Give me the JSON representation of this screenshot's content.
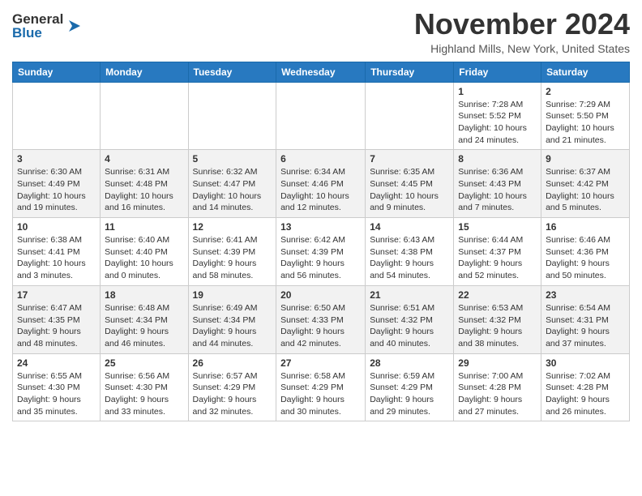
{
  "header": {
    "logo_general": "General",
    "logo_blue": "Blue",
    "title": "November 2024",
    "location": "Highland Mills, New York, United States"
  },
  "calendar": {
    "days_of_week": [
      "Sunday",
      "Monday",
      "Tuesday",
      "Wednesday",
      "Thursday",
      "Friday",
      "Saturday"
    ],
    "weeks": [
      [
        {
          "date": "",
          "info": ""
        },
        {
          "date": "",
          "info": ""
        },
        {
          "date": "",
          "info": ""
        },
        {
          "date": "",
          "info": ""
        },
        {
          "date": "",
          "info": ""
        },
        {
          "date": "1",
          "info": "Sunrise: 7:28 AM\nSunset: 5:52 PM\nDaylight: 10 hours and 24 minutes."
        },
        {
          "date": "2",
          "info": "Sunrise: 7:29 AM\nSunset: 5:50 PM\nDaylight: 10 hours and 21 minutes."
        }
      ],
      [
        {
          "date": "3",
          "info": "Sunrise: 6:30 AM\nSunset: 4:49 PM\nDaylight: 10 hours and 19 minutes."
        },
        {
          "date": "4",
          "info": "Sunrise: 6:31 AM\nSunset: 4:48 PM\nDaylight: 10 hours and 16 minutes."
        },
        {
          "date": "5",
          "info": "Sunrise: 6:32 AM\nSunset: 4:47 PM\nDaylight: 10 hours and 14 minutes."
        },
        {
          "date": "6",
          "info": "Sunrise: 6:34 AM\nSunset: 4:46 PM\nDaylight: 10 hours and 12 minutes."
        },
        {
          "date": "7",
          "info": "Sunrise: 6:35 AM\nSunset: 4:45 PM\nDaylight: 10 hours and 9 minutes."
        },
        {
          "date": "8",
          "info": "Sunrise: 6:36 AM\nSunset: 4:43 PM\nDaylight: 10 hours and 7 minutes."
        },
        {
          "date": "9",
          "info": "Sunrise: 6:37 AM\nSunset: 4:42 PM\nDaylight: 10 hours and 5 minutes."
        }
      ],
      [
        {
          "date": "10",
          "info": "Sunrise: 6:38 AM\nSunset: 4:41 PM\nDaylight: 10 hours and 3 minutes."
        },
        {
          "date": "11",
          "info": "Sunrise: 6:40 AM\nSunset: 4:40 PM\nDaylight: 10 hours and 0 minutes."
        },
        {
          "date": "12",
          "info": "Sunrise: 6:41 AM\nSunset: 4:39 PM\nDaylight: 9 hours and 58 minutes."
        },
        {
          "date": "13",
          "info": "Sunrise: 6:42 AM\nSunset: 4:39 PM\nDaylight: 9 hours and 56 minutes."
        },
        {
          "date": "14",
          "info": "Sunrise: 6:43 AM\nSunset: 4:38 PM\nDaylight: 9 hours and 54 minutes."
        },
        {
          "date": "15",
          "info": "Sunrise: 6:44 AM\nSunset: 4:37 PM\nDaylight: 9 hours and 52 minutes."
        },
        {
          "date": "16",
          "info": "Sunrise: 6:46 AM\nSunset: 4:36 PM\nDaylight: 9 hours and 50 minutes."
        }
      ],
      [
        {
          "date": "17",
          "info": "Sunrise: 6:47 AM\nSunset: 4:35 PM\nDaylight: 9 hours and 48 minutes."
        },
        {
          "date": "18",
          "info": "Sunrise: 6:48 AM\nSunset: 4:34 PM\nDaylight: 9 hours and 46 minutes."
        },
        {
          "date": "19",
          "info": "Sunrise: 6:49 AM\nSunset: 4:34 PM\nDaylight: 9 hours and 44 minutes."
        },
        {
          "date": "20",
          "info": "Sunrise: 6:50 AM\nSunset: 4:33 PM\nDaylight: 9 hours and 42 minutes."
        },
        {
          "date": "21",
          "info": "Sunrise: 6:51 AM\nSunset: 4:32 PM\nDaylight: 9 hours and 40 minutes."
        },
        {
          "date": "22",
          "info": "Sunrise: 6:53 AM\nSunset: 4:32 PM\nDaylight: 9 hours and 38 minutes."
        },
        {
          "date": "23",
          "info": "Sunrise: 6:54 AM\nSunset: 4:31 PM\nDaylight: 9 hours and 37 minutes."
        }
      ],
      [
        {
          "date": "24",
          "info": "Sunrise: 6:55 AM\nSunset: 4:30 PM\nDaylight: 9 hours and 35 minutes."
        },
        {
          "date": "25",
          "info": "Sunrise: 6:56 AM\nSunset: 4:30 PM\nDaylight: 9 hours and 33 minutes."
        },
        {
          "date": "26",
          "info": "Sunrise: 6:57 AM\nSunset: 4:29 PM\nDaylight: 9 hours and 32 minutes."
        },
        {
          "date": "27",
          "info": "Sunrise: 6:58 AM\nSunset: 4:29 PM\nDaylight: 9 hours and 30 minutes."
        },
        {
          "date": "28",
          "info": "Sunrise: 6:59 AM\nSunset: 4:29 PM\nDaylight: 9 hours and 29 minutes."
        },
        {
          "date": "29",
          "info": "Sunrise: 7:00 AM\nSunset: 4:28 PM\nDaylight: 9 hours and 27 minutes."
        },
        {
          "date": "30",
          "info": "Sunrise: 7:02 AM\nSunset: 4:28 PM\nDaylight: 9 hours and 26 minutes."
        }
      ]
    ]
  }
}
